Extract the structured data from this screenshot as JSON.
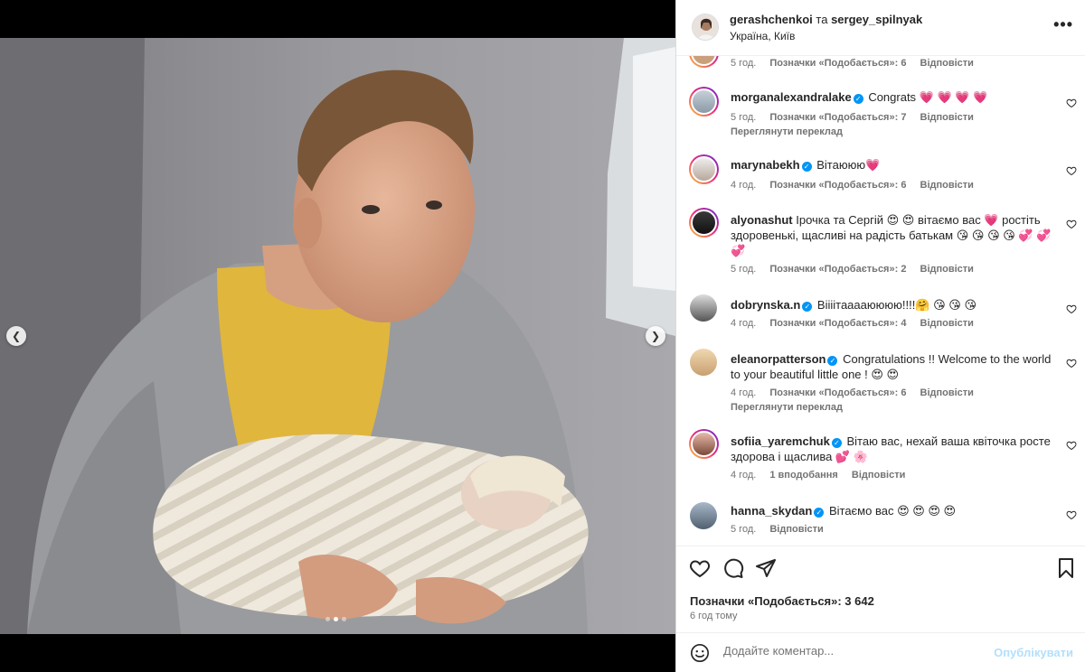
{
  "post": {
    "author": "gerashchenkoi",
    "connector": "та",
    "coauthor": "sergey_spilnyak",
    "location": "Україна, Київ",
    "more_icon": "more-dots-icon"
  },
  "carousel": {
    "prev_icon": "chevron-left-icon",
    "next_icon": "chevron-right-icon",
    "slide_count": 3,
    "active_slide": 2
  },
  "comments": [
    {
      "user": "",
      "verified": false,
      "text": "",
      "meta": [
        "5 год.",
        "Позначки «Подобається»: 6",
        "Відповісти"
      ],
      "translate": ""
    },
    {
      "user": "morganalexandralake",
      "verified": true,
      "text": "Congrats 💗 💗 💗 💗",
      "meta": [
        "5 год.",
        "Позначки «Подобається»: 7",
        "Відповісти"
      ],
      "translate": "Переглянути переклад"
    },
    {
      "user": "marynabekh",
      "verified": true,
      "text": "Вітаююю💗",
      "meta": [
        "4 год.",
        "Позначки «Подобається»: 6",
        "Відповісти"
      ],
      "translate": ""
    },
    {
      "user": "alyonashut",
      "verified": false,
      "text": "Ірочка та Сергій 😍 😍 вітаємо вас 💗 ростіть здоровенькі, щасливі на радість батькам 😘 😘 😘 😘 💞 💞 💞",
      "meta": [
        "5 год.",
        "Позначки «Подобається»: 2",
        "Відповісти"
      ],
      "translate": ""
    },
    {
      "user": "dobrynska.n",
      "verified": true,
      "text": "Віііітааааюююю!!!!🤗 😘 😘 😘",
      "meta": [
        "4 год.",
        "Позначки «Подобається»: 4",
        "Відповісти"
      ],
      "translate": ""
    },
    {
      "user": "eleanorpatterson",
      "verified": true,
      "text": "Congratulations !! Welcome to the world to your beautiful little one ! 😍 😍",
      "meta": [
        "4 год.",
        "Позначки «Подобається»: 6",
        "Відповісти"
      ],
      "translate": "Переглянути переклад"
    },
    {
      "user": "sofiia_yaremchuk",
      "verified": true,
      "text": "Вітаю вас, нехай ваша квіточка росте здорова і щаслива 💕 🌸",
      "meta": [
        "4 год.",
        "1 вподобання",
        "Відповісти"
      ],
      "translate": ""
    },
    {
      "user": "hanna_skydan",
      "verified": true,
      "text": "Вітаємо вас 😍 😍 😍 😍",
      "meta": [
        "5 год.",
        "Відповісти"
      ],
      "translate": ""
    }
  ],
  "actions": {
    "like_icon": "heart-icon",
    "comment_icon": "comment-icon",
    "share_icon": "share-icon",
    "save_icon": "bookmark-icon",
    "likes_text": "Позначки «Подобається»: 3 642",
    "time_ago": "6 год тому"
  },
  "add_comment": {
    "emoji_icon": "emoji-icon",
    "placeholder": "Додайте коментар...",
    "post_label": "Опублікувати"
  },
  "colors": {
    "verified": "#0095f6",
    "muted_text": "#737373",
    "post_button_disabled": "#b2dffc"
  }
}
